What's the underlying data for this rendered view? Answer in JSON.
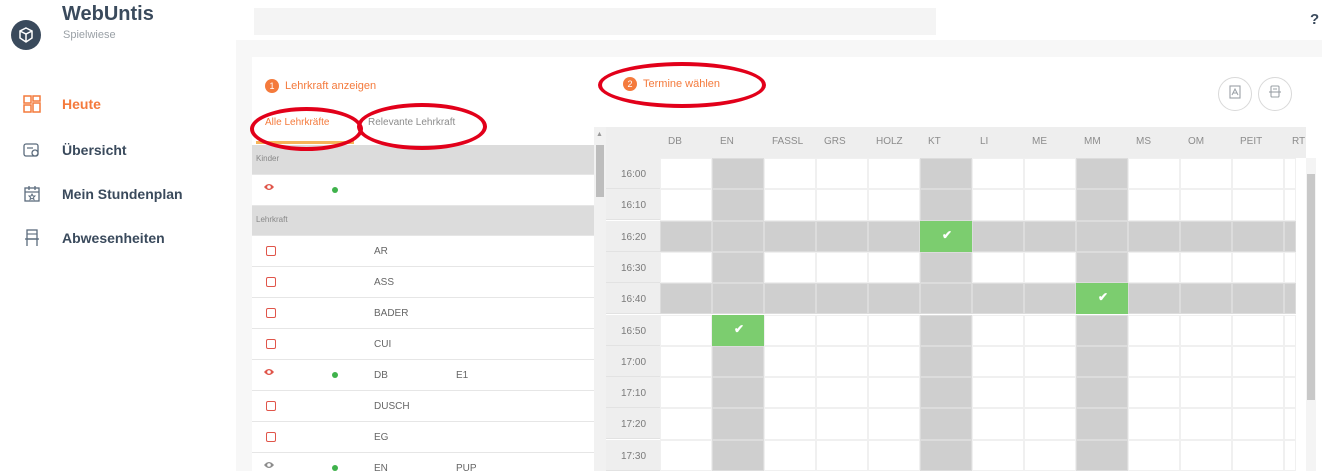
{
  "app": {
    "title": "WebUntis",
    "subtitle": "Spielwiese",
    "help": "?"
  },
  "nav": [
    {
      "label": "Heute",
      "icon": "dashboard-icon",
      "active": true
    },
    {
      "label": "Übersicht",
      "icon": "overview-icon",
      "active": false
    },
    {
      "label": "Mein Stundenplan",
      "icon": "calendar-icon",
      "active": false
    },
    {
      "label": "Abwesenheiten",
      "icon": "absence-icon",
      "active": false
    }
  ],
  "steps": {
    "step1": {
      "num": "1",
      "label": "Lehrkraft anzeigen"
    },
    "step2": {
      "num": "2",
      "label": "Termine wählen"
    }
  },
  "tabs": {
    "all": "Alle Lehrkräfte",
    "relevant": "Relevante Lehrkraft"
  },
  "list": {
    "section_children": "Kinder",
    "section_teachers": "Lehrkraft",
    "rows": [
      {
        "marker": "eye",
        "dot": true,
        "code": "",
        "extra": ""
      },
      {
        "marker": "checkbox",
        "dot": false,
        "code": "AR",
        "extra": ""
      },
      {
        "marker": "checkbox",
        "dot": false,
        "code": "ASS",
        "extra": ""
      },
      {
        "marker": "checkbox",
        "dot": false,
        "code": "BADER",
        "extra": ""
      },
      {
        "marker": "checkbox",
        "dot": false,
        "code": "CUI",
        "extra": ""
      },
      {
        "marker": "eye",
        "dot": true,
        "code": "DB",
        "extra": "E1"
      },
      {
        "marker": "checkbox",
        "dot": false,
        "code": "DUSCH",
        "extra": ""
      },
      {
        "marker": "checkbox",
        "dot": false,
        "code": "EG",
        "extra": ""
      },
      {
        "marker": "eye-grey",
        "dot": true,
        "code": "EN",
        "extra": "PUP"
      }
    ]
  },
  "grid": {
    "columns": [
      "DB",
      "EN",
      "FASSL",
      "GRS",
      "HOLZ",
      "KT",
      "LI",
      "ME",
      "MM",
      "MS",
      "OM",
      "PEIT",
      "RT"
    ],
    "times": [
      "16:00",
      "16:10",
      "16:20",
      "16:30",
      "16:40",
      "16:50",
      "17:00",
      "17:10",
      "17:20",
      "17:30"
    ],
    "grey_rows": [
      "16:20",
      "16:40"
    ],
    "grey_columns": [
      "EN",
      "KT",
      "MM"
    ],
    "selected": [
      {
        "time": "16:20",
        "column": "KT"
      },
      {
        "time": "16:40",
        "column": "MM"
      },
      {
        "time": "16:50",
        "column": "EN"
      }
    ],
    "check_symbol": "✔"
  },
  "colors": {
    "accent": "#f47a3c",
    "annotation": "#e2001a",
    "selected": "#7ccd6f",
    "busy": "#cfcfcf"
  }
}
